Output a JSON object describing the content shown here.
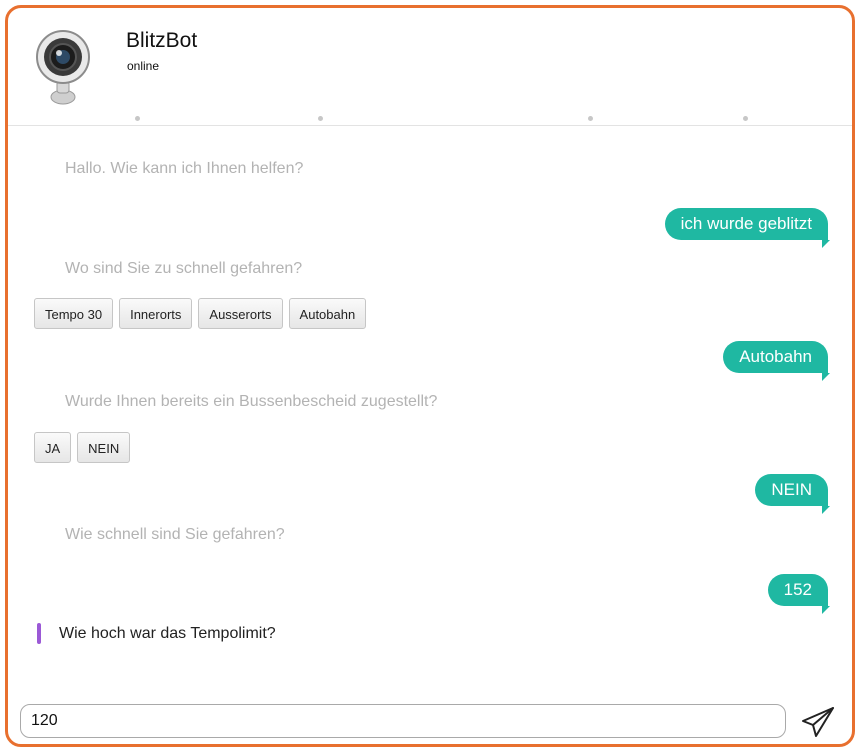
{
  "header": {
    "bot_name": "BlitzBot",
    "status": "online"
  },
  "conversation": {
    "greeting": "Hallo. Wie kann ich Ihnen helfen?",
    "reply_1": "ich wurde geblitzt",
    "question_location": "Wo sind Sie zu schnell gefahren?",
    "location_options": [
      "Tempo 30",
      "Innerorts",
      "Ausserorts",
      "Autobahn"
    ],
    "reply_2": "Autobahn",
    "question_notice": "Wurde Ihnen bereits ein Bussenbescheid zugestellt?",
    "notice_options": [
      "JA",
      "NEIN"
    ],
    "reply_3": "NEIN",
    "question_speed": "Wie schnell sind Sie gefahren?",
    "reply_4": "152",
    "current_question": "Wie hoch war das Tempolimit?"
  },
  "composer": {
    "input_value": "120",
    "send_icon": "paper-plane-icon"
  },
  "colors": {
    "frame_border": "#e8702f",
    "user_bubble": "#1fb8a2",
    "question_marker": "#9b59d6"
  }
}
